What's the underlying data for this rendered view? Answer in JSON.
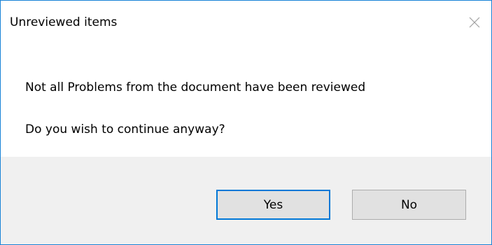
{
  "dialog": {
    "title": "Unreviewed items",
    "close_icon": "close-icon",
    "message_line_1": "Not all Problems from the document have been reviewed",
    "message_line_2": "Do you wish to continue anyway?",
    "buttons": {
      "yes_label": "Yes",
      "no_label": "No"
    },
    "colors": {
      "window_border": "#1883d7",
      "default_button_border": "#0078d7",
      "button_area_bg": "#f0f0f0",
      "button_bg": "#e1e1e1"
    }
  }
}
